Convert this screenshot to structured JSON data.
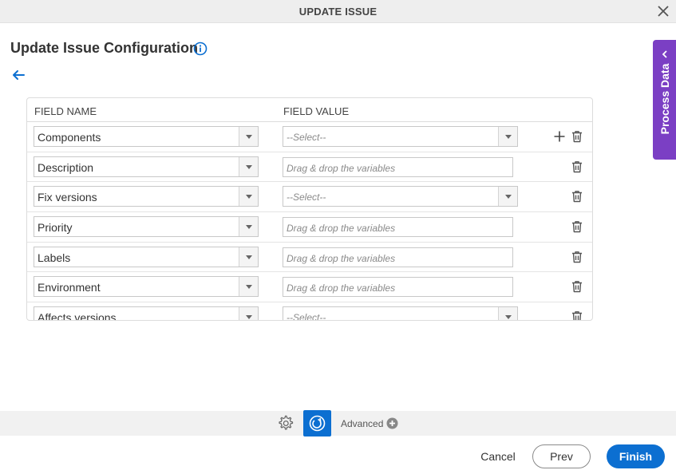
{
  "dialog": {
    "title": "UPDATE ISSUE",
    "close_icon": "close-icon"
  },
  "page": {
    "title": "Update Issue Configuration",
    "info_icon": "info-icon",
    "back_icon": "back-arrow-icon"
  },
  "grid": {
    "headers": {
      "field_name": "FIELD NAME",
      "field_value": "FIELD VALUE"
    },
    "rows": [
      {
        "field": "Components",
        "value_type": "select",
        "value": "--Select--",
        "show_add": true
      },
      {
        "field": "Description",
        "value_type": "text",
        "value": "Drag & drop the variables",
        "show_add": false
      },
      {
        "field": "Fix versions",
        "value_type": "select",
        "value": "--Select--",
        "show_add": false
      },
      {
        "field": "Priority",
        "value_type": "text",
        "value": "Drag & drop the variables",
        "show_add": false
      },
      {
        "field": "Labels",
        "value_type": "text",
        "value": "Drag & drop the variables",
        "show_add": false
      },
      {
        "field": "Environment",
        "value_type": "text",
        "value": "Drag & drop the variables",
        "show_add": false
      },
      {
        "field": "Affects versions",
        "value_type": "select",
        "value": "--Select--",
        "show_add": false
      }
    ]
  },
  "side_panel": {
    "label": "Process Data"
  },
  "advanced_bar": {
    "label": "Advanced"
  },
  "footer": {
    "cancel": "Cancel",
    "prev": "Prev",
    "finish": "Finish"
  },
  "colors": {
    "accent": "#0c6fd1",
    "side_tab": "#7b3fc4"
  }
}
